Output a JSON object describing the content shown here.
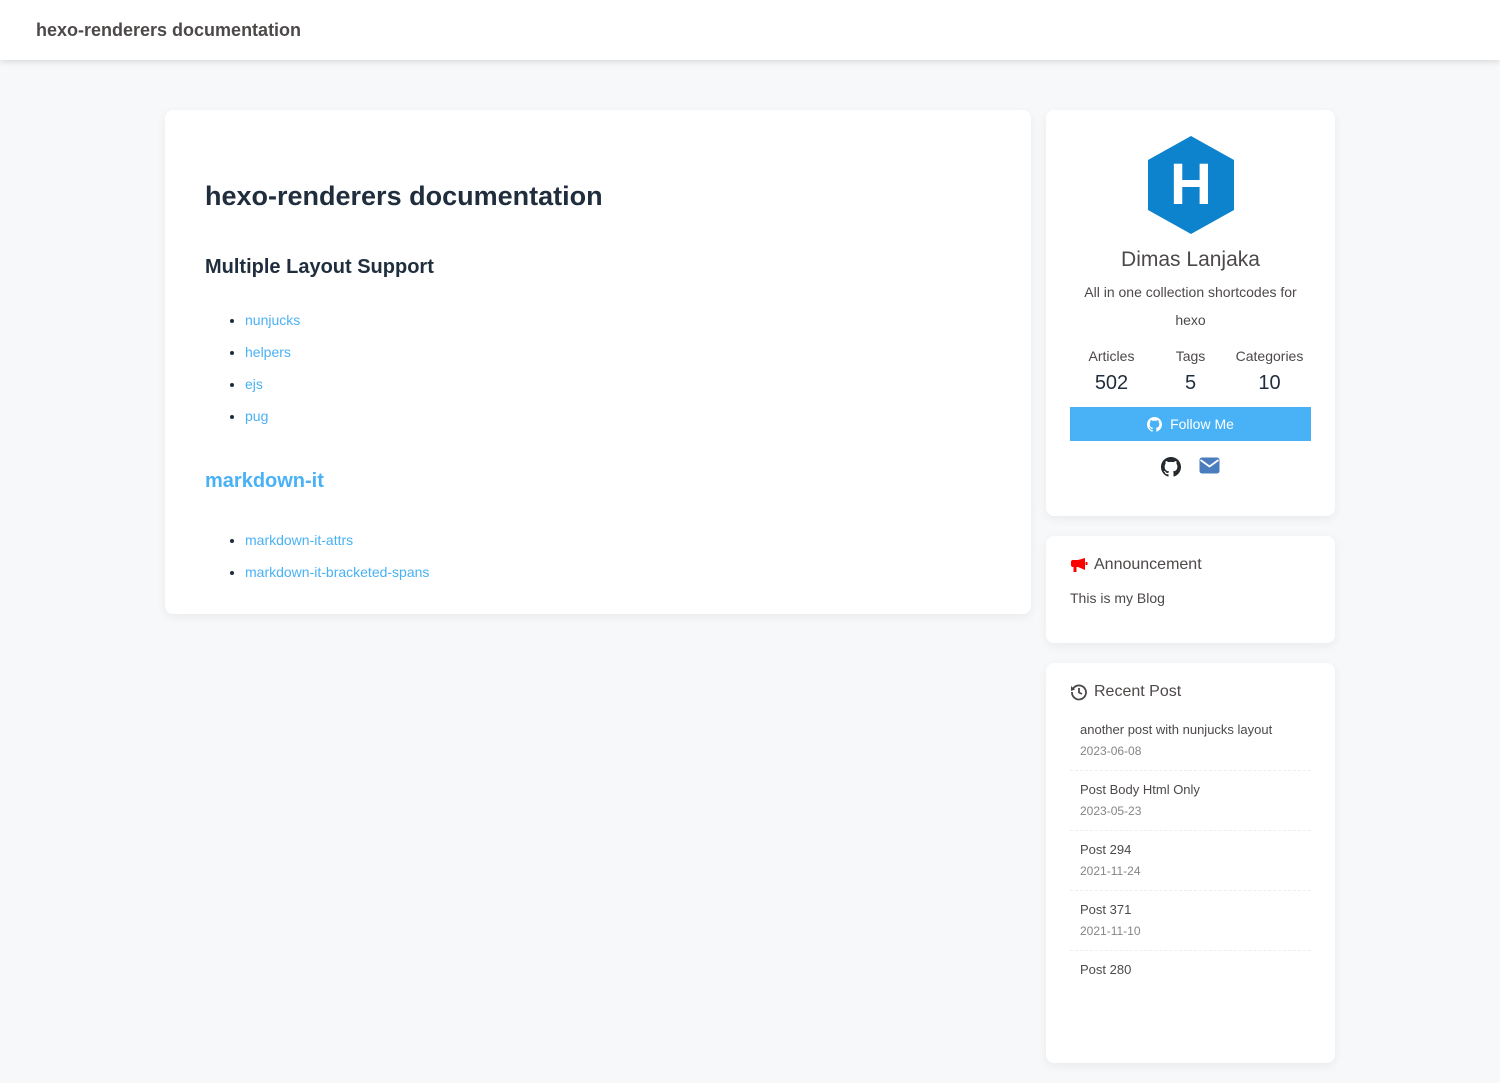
{
  "header": {
    "site_title": "hexo-renderers documentation"
  },
  "article": {
    "title": "hexo-renderers documentation",
    "section1": {
      "heading": "Multiple Layout Support",
      "items": [
        "nunjucks",
        "helpers",
        "ejs",
        "pug"
      ]
    },
    "section2": {
      "heading": "markdown-it",
      "items": [
        "markdown-it-attrs",
        "markdown-it-bracketed-spans"
      ]
    }
  },
  "author": {
    "logo_letter": "H",
    "name": "Dimas Lanjaka",
    "description": "All in one collection shortcodes for hexo",
    "stats": [
      {
        "label": "Articles",
        "value": "502"
      },
      {
        "label": "Tags",
        "value": "5"
      },
      {
        "label": "Categories",
        "value": "10"
      }
    ],
    "follow_label": "Follow Me",
    "social_icons": [
      "github-icon",
      "envelope-icon"
    ]
  },
  "announcement": {
    "title": "Announcement",
    "text": "This is my Blog"
  },
  "recent": {
    "title": "Recent Post",
    "items": [
      {
        "title": "another post with nunjucks layout",
        "date": "2023-06-08"
      },
      {
        "title": "Post Body Html Only",
        "date": "2023-05-23"
      },
      {
        "title": "Post 294",
        "date": "2021-11-24"
      },
      {
        "title": "Post 371",
        "date": "2021-11-10"
      },
      {
        "title": "Post 280",
        "date": ""
      }
    ]
  },
  "colors": {
    "accent": "#49b1f5",
    "logo": "#0e83cd",
    "announce_icon": "#ff0000",
    "mail": "#4a7dbe"
  }
}
